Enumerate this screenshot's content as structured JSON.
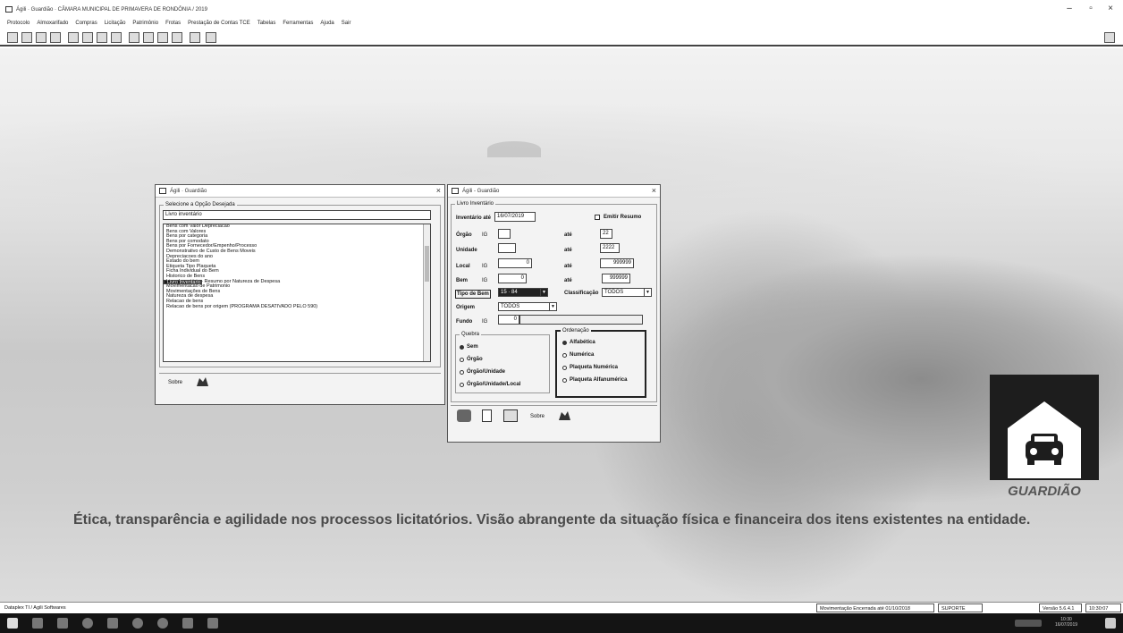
{
  "app": {
    "title": "Ágili · Guardião · CÂMARA MUNICIPAL DE PRIMAVERA DE RONDÔNIA / 2019"
  },
  "menu": [
    "Protocolo",
    "Almoxarifado",
    "Compras",
    "Licitação",
    "Patrimônio",
    "Frotas",
    "Prestação de Contas TCE",
    "Tabelas",
    "Ferramentas",
    "Ajuda",
    "Sair"
  ],
  "window_controls": {
    "minimize": "–",
    "restore": "▫",
    "close": "×"
  },
  "selector": {
    "title": "Ágili · Guardião",
    "group_label": "Selecione a Opção Desejada",
    "current": "Livro inventário",
    "items": [
      "Bens com Valor Depreciacao",
      "Bens com Valores",
      "Bens por categoria",
      "Bens por comodato",
      "Bens por Fornecedor/Empenho/Processo",
      "Demonstrativo de Custo de Bens Moveis",
      "Depreciacoes do ano",
      "Estado do bem",
      "Etiqueta Tipo Plaqueta",
      "Ficha Individual do Bem",
      "Historico de Bens",
      "Livro Inventario",
      "Livro Inventário - Resumo por Natureza de Despesa",
      "Movimentacao de Patrimonio",
      "Movimentações de Bens",
      "Natureza de despesa",
      "Relacao de bens",
      "Relacao de bens por origem (PROGRAMA DESATIVADO PELO 590)"
    ],
    "selected_index": 11,
    "about": "Sobre"
  },
  "inventory": {
    "title": "Ágili - Guardião",
    "group_label": "Livro Inventário",
    "ate_label": "Inventário até",
    "ate_value": "16/07/2019",
    "summary_label": "Emitir Resumo",
    "orgao_label": "Órgão",
    "orgao_to": "22",
    "unidade_label": "Unidade",
    "unidade_to": "2222",
    "local_label": "Local",
    "local_from": "0",
    "local_to": "999999",
    "bem_label": "Bem",
    "bem_from": "0",
    "bem_to": "999999",
    "tipo_label": "Tipo de Bem",
    "tipo_value": "15 · 84",
    "class_label": "Classificação",
    "class_value": "TODOS",
    "origem_label": "Origem",
    "origem_value": "TODOS",
    "fundo_label": "Fundo",
    "fundo_value": "0",
    "ate": "até",
    "picker": "IG",
    "quebra_label": "Quebra",
    "quebra_options": [
      "Sem",
      "Órgão",
      "Órgão/Unidade",
      "Órgão/Unidade/Local"
    ],
    "ordenacao_label": "Ordenação",
    "ordenacao_options": [
      "Alfabética",
      "Numérica",
      "Plaqueta Numérica",
      "Plaqueta Alfanumérica"
    ],
    "about": "Sobre"
  },
  "background": {
    "slogan": "Ética, transparência e agilidade nos processos licitatórios. Visão abrangente da situação física e financeira dos itens existentes na entidade.",
    "logo_text": "GUARDIÃO"
  },
  "status": {
    "left": "Dataplex TI / Agili Softwares",
    "movement": "Movimentação Encerrada até 01/10/2018",
    "user": "SUPORTE",
    "version": "Versão 5.6.4.1",
    "time": "10:30:07"
  },
  "taskbar": {
    "clock_time": "10:30",
    "clock_date": "16/07/2019"
  }
}
